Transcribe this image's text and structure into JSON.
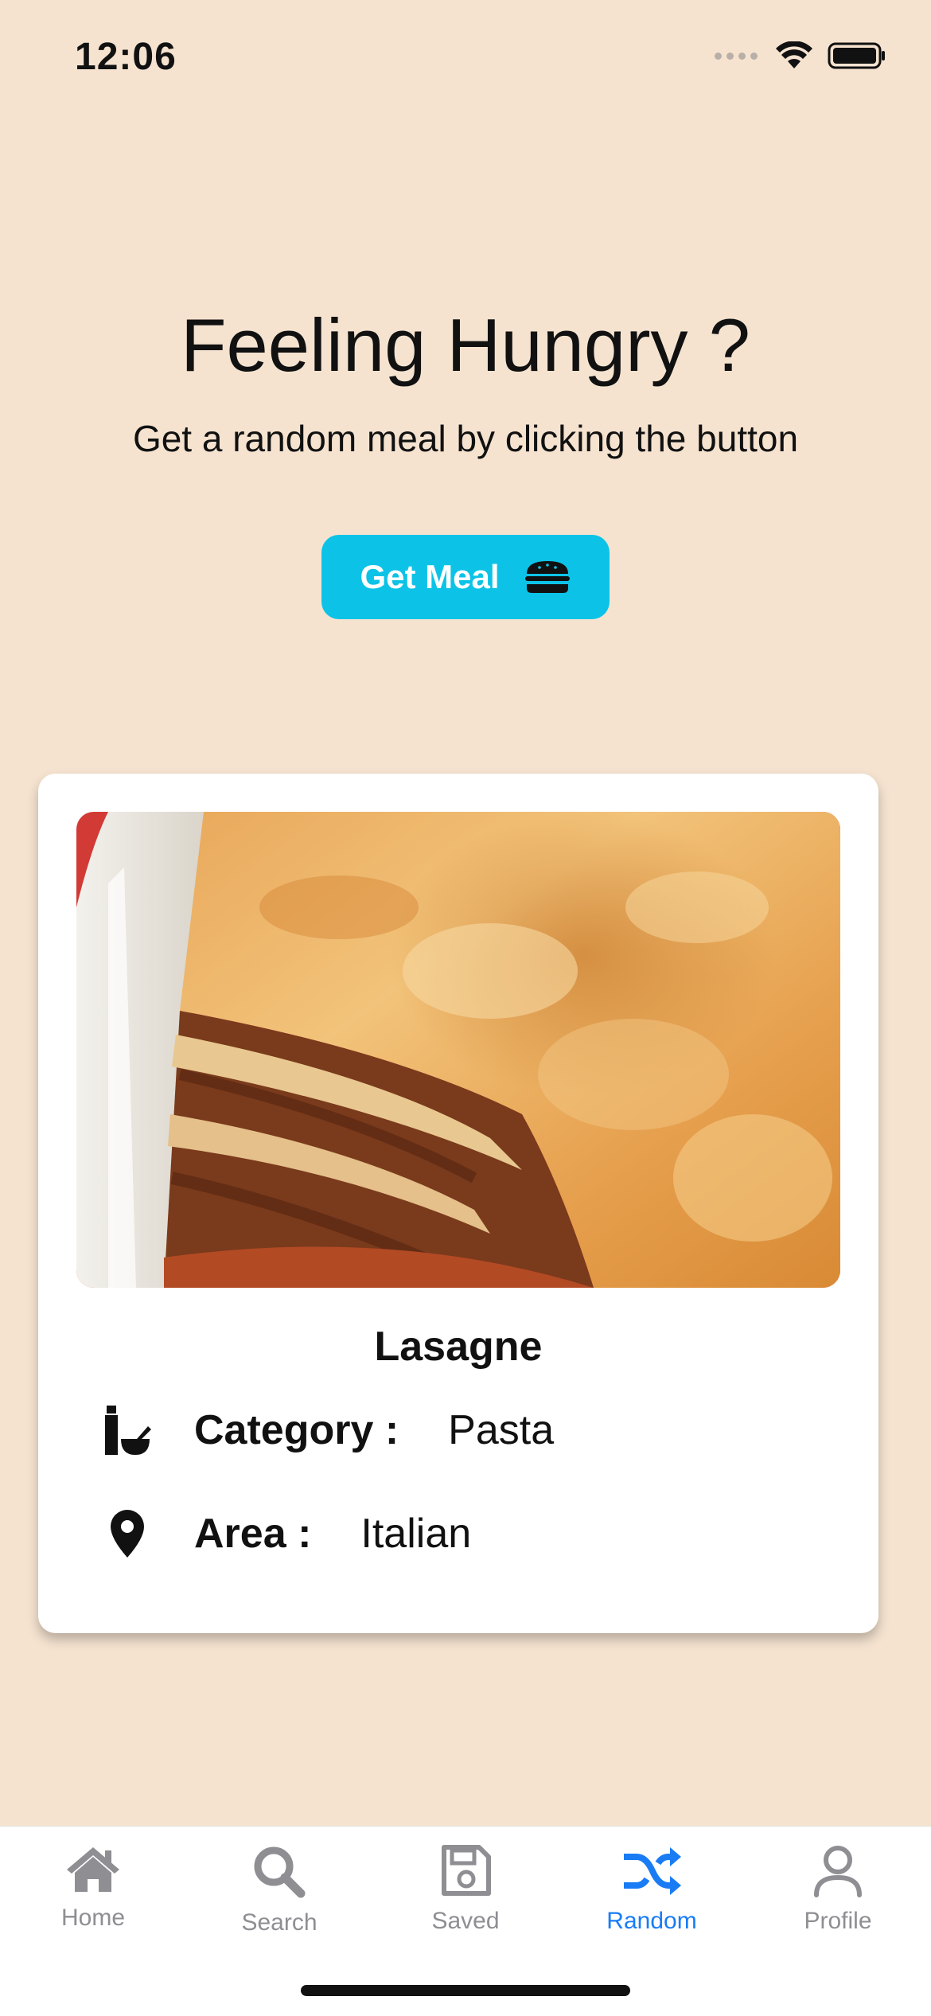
{
  "status_bar": {
    "time": "12:06"
  },
  "hero": {
    "title": "Feeling Hungry ?",
    "subtitle": "Get a random meal by clicking the button",
    "button_label": "Get Meal",
    "button_icon": "burger-icon",
    "button_color": "#0cc3e7"
  },
  "meal": {
    "name": "Lasagne",
    "category_label": "Category :",
    "category_value": "Pasta",
    "category_icon": "bottle-mortar-icon",
    "area_label": "Area :",
    "area_value": "Italian",
    "area_icon": "map-pin-icon"
  },
  "tab_bar": {
    "active_color": "#1a7cf5",
    "inactive_color": "#8e8e93",
    "tabs": [
      {
        "label": "Home",
        "icon": "home-icon",
        "active": false
      },
      {
        "label": "Search",
        "icon": "search-icon",
        "active": false
      },
      {
        "label": "Saved",
        "icon": "save-icon",
        "active": false
      },
      {
        "label": "Random",
        "icon": "shuffle-icon",
        "active": true
      },
      {
        "label": "Profile",
        "icon": "user-icon",
        "active": false
      }
    ]
  },
  "colors": {
    "background": "#f5e3d0",
    "card": "#ffffff"
  }
}
